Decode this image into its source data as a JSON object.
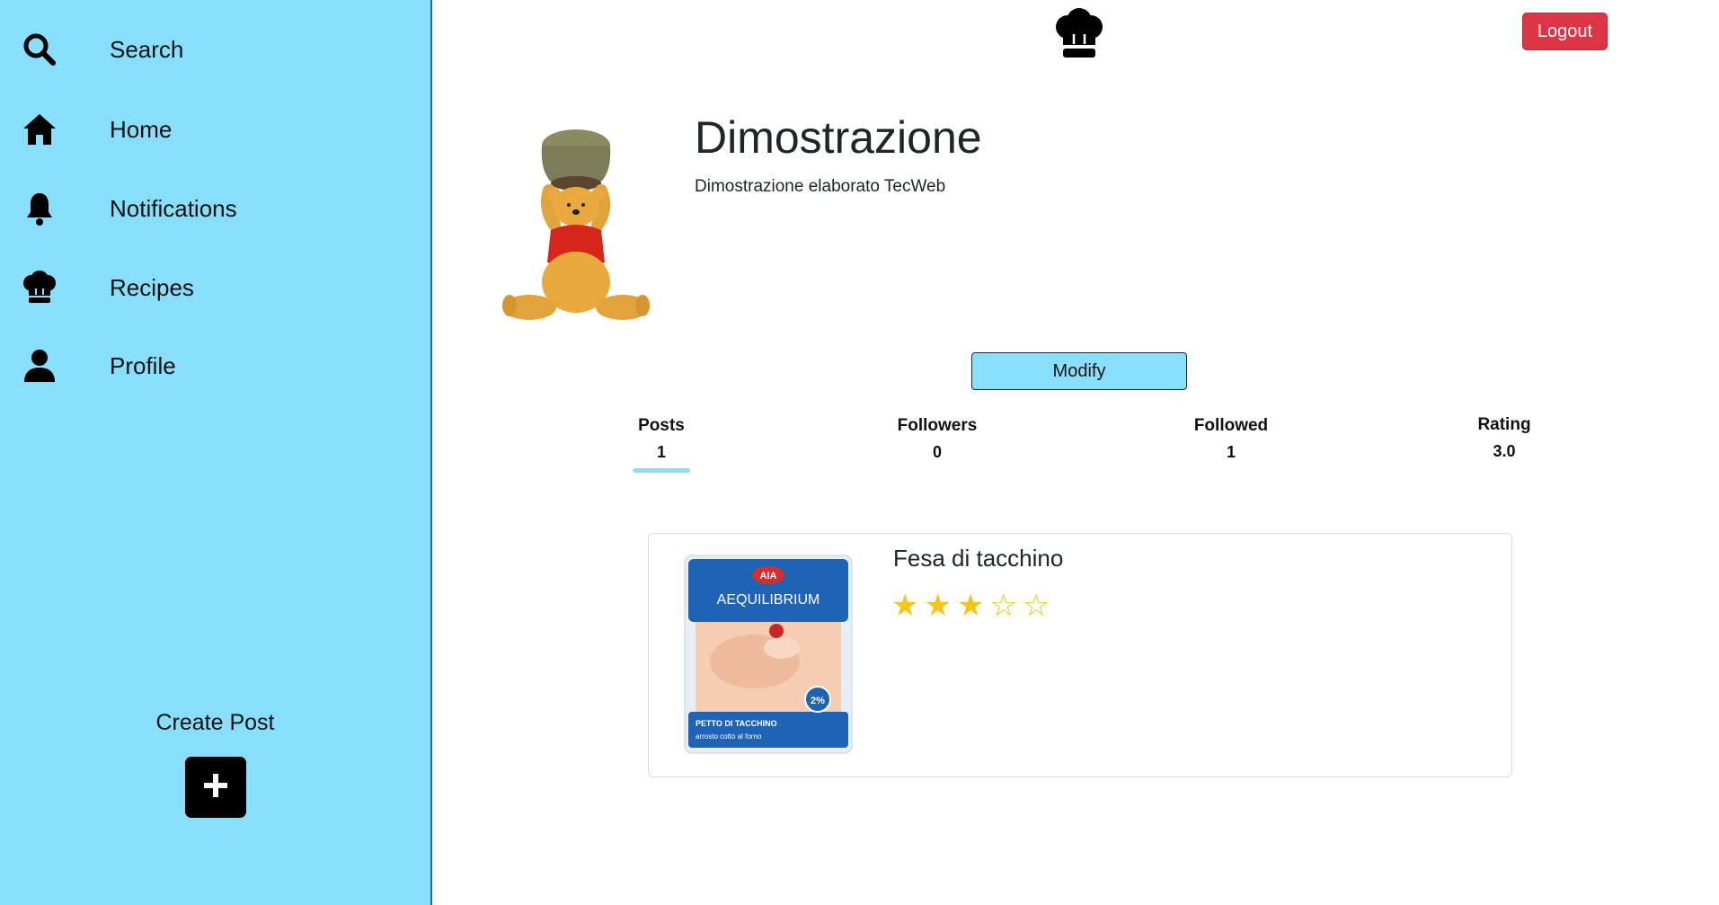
{
  "sidebar": {
    "items": [
      {
        "label": "Search",
        "icon": "search-icon"
      },
      {
        "label": "Home",
        "icon": "home-icon"
      },
      {
        "label": "Notifications",
        "icon": "bell-icon"
      },
      {
        "label": "Recipes",
        "icon": "chef-hat-icon"
      },
      {
        "label": "Profile",
        "icon": "user-icon"
      }
    ],
    "create_post_label": "Create Post"
  },
  "header": {
    "logo_icon": "chef-hat-icon",
    "logout_label": "Logout"
  },
  "profile": {
    "name": "Dimostrazione",
    "bio": "Dimostrazione elaborato TecWeb",
    "modify_label": "Modify"
  },
  "stats": [
    {
      "label": "Posts",
      "value": "1",
      "active": true
    },
    {
      "label": "Followers",
      "value": "0",
      "active": false
    },
    {
      "label": "Followed",
      "value": "1",
      "active": false
    },
    {
      "label": "Rating",
      "value": "3.0",
      "active": false
    }
  ],
  "posts": [
    {
      "title": "Fesa di tacchino",
      "rating": 3,
      "max_rating": 5,
      "stars": "★★★☆☆",
      "image_text": {
        "brand": "AIA",
        "product": "AEQUILIBRIUM",
        "desc": "PETTO DI TACCHINO",
        "sub": "arrosto cotto al forno",
        "badge": "2%"
      }
    }
  ],
  "colors": {
    "sidebar_bg": "#87dffb",
    "logout_bg": "#dc3545",
    "star": "#f5c518",
    "accent": "#87dffb"
  }
}
